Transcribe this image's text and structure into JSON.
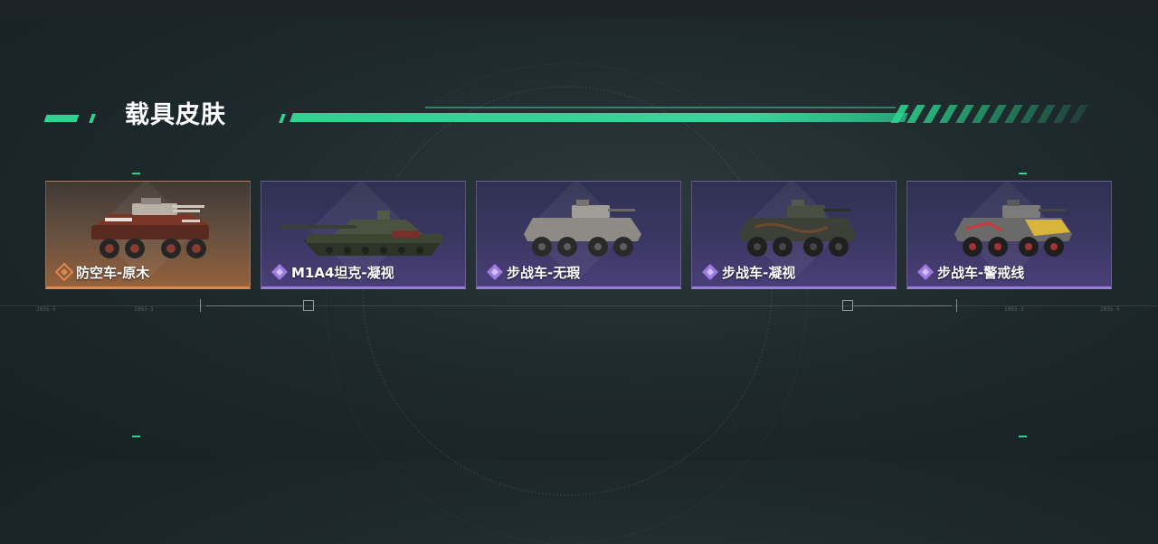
{
  "header": {
    "title": "载具皮肤"
  },
  "colors": {
    "accent": "#2bd48f",
    "purple_rarity": "#9d7be0",
    "orange_rarity": "#e0874a"
  },
  "cards": [
    {
      "label": "防空车-原木",
      "rarity": "orange",
      "icon": "orange-diamond-icon"
    },
    {
      "label": "M1A4坦克-凝视",
      "rarity": "purple",
      "icon": "purple-diamond-icon"
    },
    {
      "label": "步战车-无瑕",
      "rarity": "purple",
      "icon": "purple-diamond-icon"
    },
    {
      "label": "步战车-凝视",
      "rarity": "purple",
      "icon": "purple-diamond-icon"
    },
    {
      "label": "步战车-警戒线",
      "rarity": "purple",
      "icon": "purple-diamond-icon"
    }
  ],
  "hud": {
    "left_readout_1": "2035-5",
    "left_readout_2": "1993-3",
    "right_readout_1": "1993-3",
    "right_readout_2": "2035-5"
  }
}
